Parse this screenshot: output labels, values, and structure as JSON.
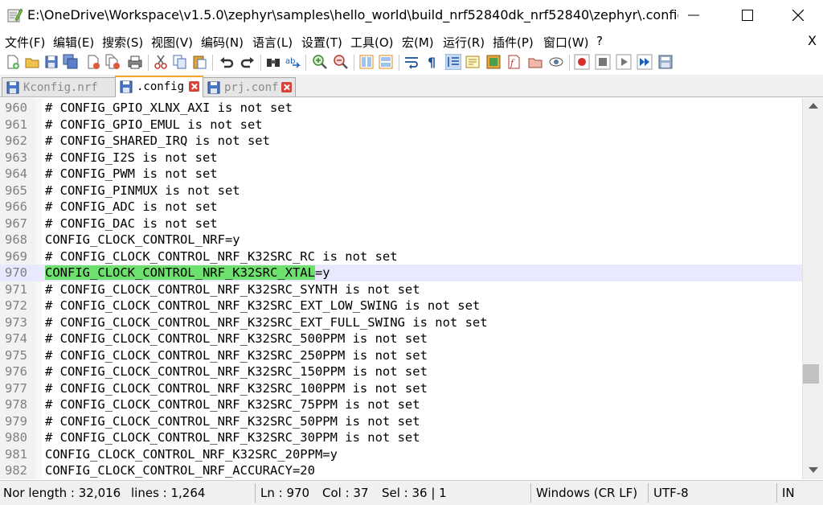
{
  "window": {
    "title": "E:\\OneDrive\\Workspace\\v1.5.0\\zephyr\\samples\\hello_world\\build_nrf52840dk_nrf52840\\zephyr\\.config -..."
  },
  "menu": {
    "items": [
      "文件(F)",
      "编辑(E)",
      "搜索(S)",
      "视图(V)",
      "编码(N)",
      "语言(L)",
      "设置(T)",
      "工具(O)",
      "宏(M)",
      "运行(R)",
      "插件(P)",
      "窗口(W)",
      "?"
    ],
    "close_label": "X"
  },
  "toolbar": {
    "icons": [
      "new-file-icon",
      "open-file-icon",
      "save-icon",
      "save-all-icon",
      "close-icon",
      "close-all-icon",
      "print-icon",
      "cut-icon",
      "copy-icon",
      "paste-icon",
      "undo-icon",
      "redo-icon",
      "find-icon",
      "replace-icon",
      "zoom-in-icon",
      "zoom-out-icon",
      "sync-vertical-icon",
      "sync-horizontal-icon",
      "word-wrap-icon",
      "show-all-chars-icon",
      "indent-guide-icon",
      "doc-map-icon",
      "function-list-icon",
      "folder-workspace-icon",
      "monitoring-icon",
      "record-macro-icon",
      "stop-record-icon",
      "play-macro-icon",
      "run-macro-multiple-icon",
      "save-macro-icon"
    ]
  },
  "tabs": [
    {
      "label": "Kconfig.nrf",
      "active": false
    },
    {
      "label": ".config",
      "active": true
    },
    {
      "label": "prj.conf",
      "active": false
    }
  ],
  "editor": {
    "current_line": 970,
    "lines": [
      {
        "num": "960",
        "text": "# CONFIG_GPIO_XLNX_AXI is not set"
      },
      {
        "num": "961",
        "text": "# CONFIG_GPIO_EMUL is not set"
      },
      {
        "num": "962",
        "text": "# CONFIG_SHARED_IRQ is not set"
      },
      {
        "num": "963",
        "text": "# CONFIG_I2S is not set"
      },
      {
        "num": "964",
        "text": "# CONFIG_PWM is not set"
      },
      {
        "num": "965",
        "text": "# CONFIG_PINMUX is not set"
      },
      {
        "num": "966",
        "text": "# CONFIG_ADC is not set"
      },
      {
        "num": "967",
        "text": "# CONFIG_DAC is not set"
      },
      {
        "num": "968",
        "text": "CONFIG_CLOCK_CONTROL_NRF=y"
      },
      {
        "num": "969",
        "text": "# CONFIG_CLOCK_CONTROL_NRF_K32SRC_RC is not set"
      },
      {
        "num": "970",
        "text": "CONFIG_CLOCK_CONTROL_NRF_K32SRC_XTAL",
        "suffix": "=y"
      },
      {
        "num": "971",
        "text": "# CONFIG_CLOCK_CONTROL_NRF_K32SRC_SYNTH is not set"
      },
      {
        "num": "972",
        "text": "# CONFIG_CLOCK_CONTROL_NRF_K32SRC_EXT_LOW_SWING is not set"
      },
      {
        "num": "973",
        "text": "# CONFIG_CLOCK_CONTROL_NRF_K32SRC_EXT_FULL_SWING is not set"
      },
      {
        "num": "974",
        "text": "# CONFIG_CLOCK_CONTROL_NRF_K32SRC_500PPM is not set"
      },
      {
        "num": "975",
        "text": "# CONFIG_CLOCK_CONTROL_NRF_K32SRC_250PPM is not set"
      },
      {
        "num": "976",
        "text": "# CONFIG_CLOCK_CONTROL_NRF_K32SRC_150PPM is not set"
      },
      {
        "num": "977",
        "text": "# CONFIG_CLOCK_CONTROL_NRF_K32SRC_100PPM is not set"
      },
      {
        "num": "978",
        "text": "# CONFIG_CLOCK_CONTROL_NRF_K32SRC_75PPM is not set"
      },
      {
        "num": "979",
        "text": "# CONFIG_CLOCK_CONTROL_NRF_K32SRC_50PPM is not set"
      },
      {
        "num": "980",
        "text": "# CONFIG_CLOCK_CONTROL_NRF_K32SRC_30PPM is not set"
      },
      {
        "num": "981",
        "text": "CONFIG_CLOCK_CONTROL_NRF_K32SRC_20PPM=y"
      },
      {
        "num": "982",
        "text": "CONFIG_CLOCK_CONTROL_NRF_ACCURACY=20"
      }
    ]
  },
  "status": {
    "length": "Nor length : 32,016",
    "lines": "lines : 1,264",
    "ln": "Ln : 970",
    "col": "Col : 37",
    "sel": "Sel : 36 | 1",
    "eol": "Windows (CR LF)",
    "encoding": "UTF-8",
    "mode": "IN"
  },
  "colors": {
    "selection": "#6ee06e",
    "current_line": "#e8e8ff",
    "tab_accent": "#f5a623"
  }
}
